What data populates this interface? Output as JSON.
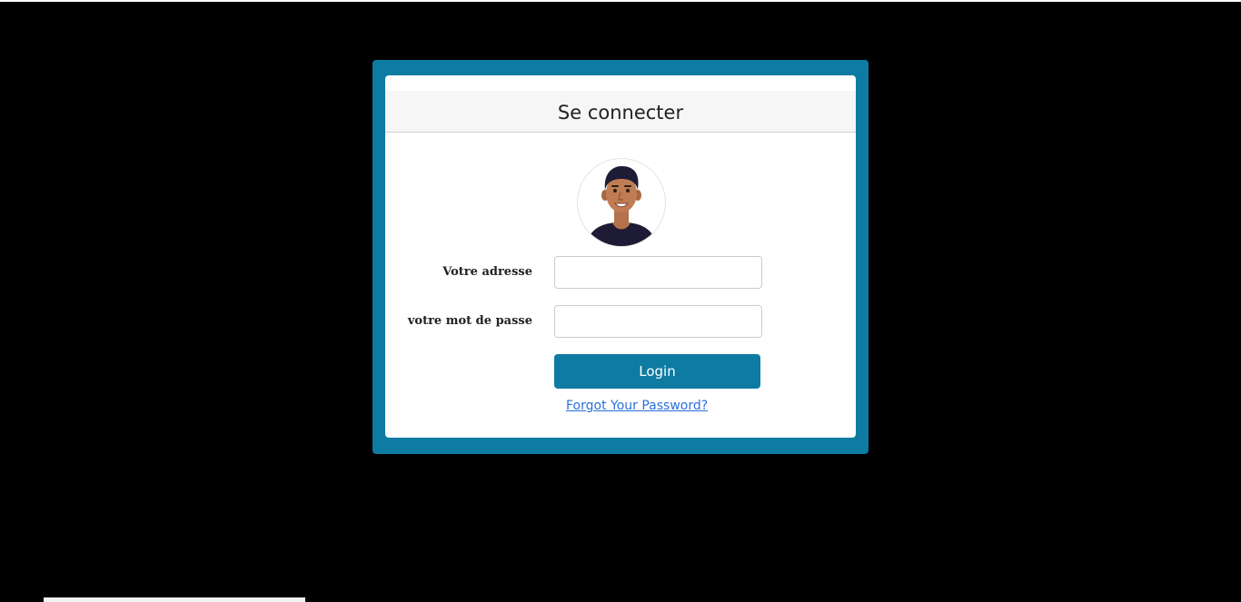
{
  "login": {
    "title": "Se connecter",
    "email_label": "Votre adresse",
    "email_value": "",
    "password_label": "votre mot de passe",
    "password_value": "",
    "login_button": "Login",
    "forgot_link": "Forgot Your Password?"
  },
  "colors": {
    "frame": "#0e7ba2",
    "button": "#0e7ba2",
    "link": "#2b6fdb",
    "page_background": "#000000"
  },
  "icons": {
    "avatar": "user-avatar-icon"
  }
}
